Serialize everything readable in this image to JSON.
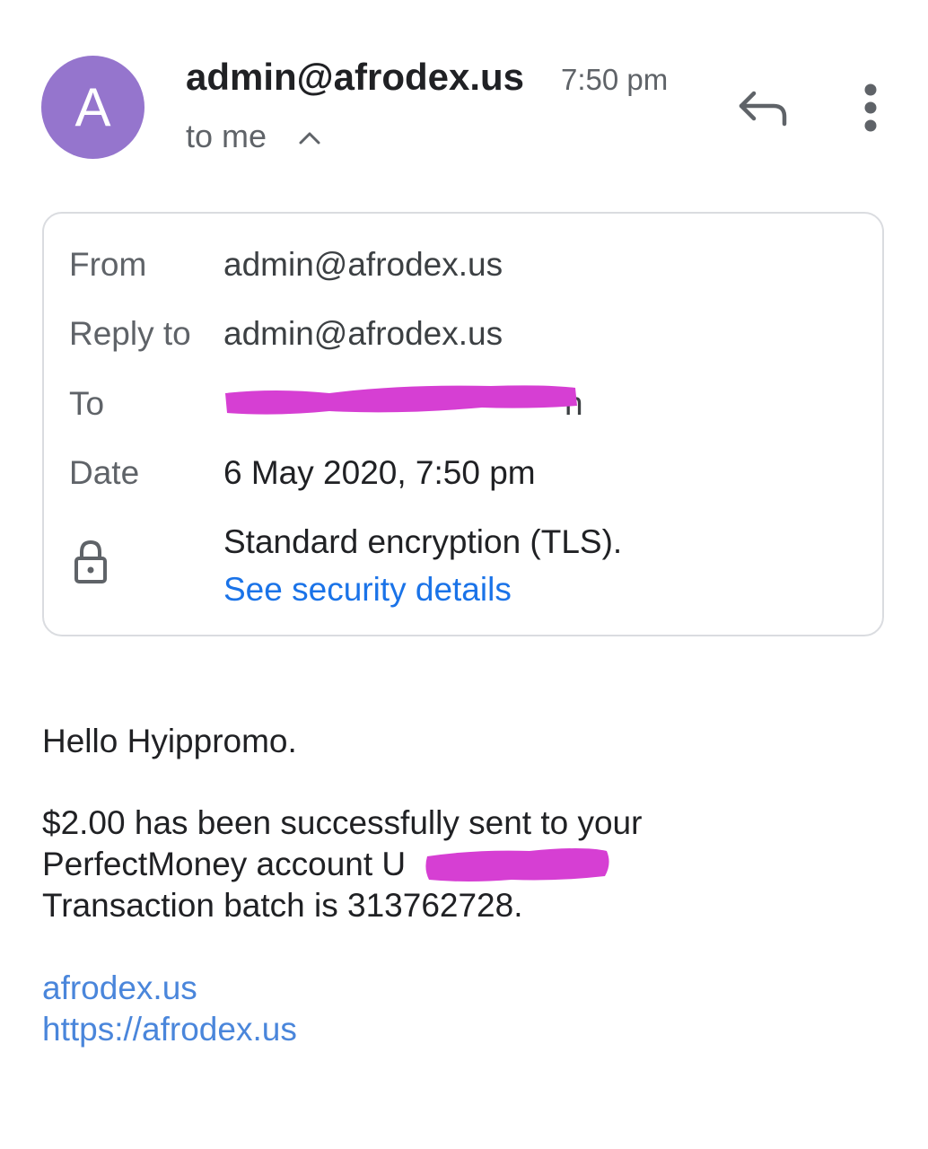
{
  "header": {
    "avatar_letter": "A",
    "sender": "admin@afrodex.us",
    "time": "7:50 pm",
    "recipient": "to me",
    "icons": {
      "expand": "chevron-up-icon",
      "reply": "reply-icon",
      "more": "more-vert-icon"
    }
  },
  "details": {
    "from_label": "From",
    "from_value": "admin@afrodex.us",
    "reply_label": "Reply to",
    "reply_value": "admin@afrodex.us",
    "to_label": "To",
    "to_value_visible": "n",
    "date_label": "Date",
    "date_value": "6 May 2020, 7:50 pm",
    "security_icon": "lock-icon",
    "security_text": "Standard encryption (TLS).",
    "security_link": "See security details"
  },
  "message": {
    "greeting": "Hello Hyippromo.",
    "line1": "$2.00 has been successfully sent to your",
    "line2": "PerfectMoney account U",
    "line3": "Transaction batch is 313762728.",
    "link1": "afrodex.us",
    "link2": "https://afrodex.us"
  },
  "colors": {
    "avatar": "#9575cd",
    "link": "#1a73e8",
    "redaction": "#d63fd3"
  }
}
